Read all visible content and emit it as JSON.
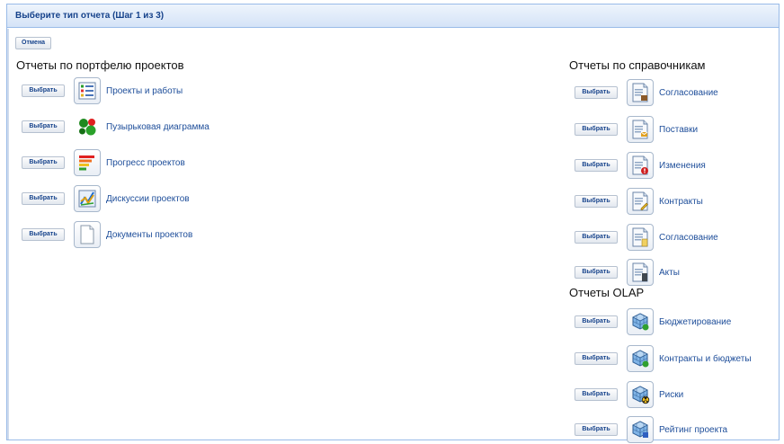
{
  "window": {
    "title": "Выберите тип отчета (Шаг 1 из 3)"
  },
  "toolbar": {
    "cancel_label": "Отмена"
  },
  "select_label": "Выбрать",
  "sections": {
    "portfolio": {
      "title": "Отчеты по портфелю проектов",
      "items": [
        {
          "label": "Проекты и работы",
          "icon": "task-list-icon"
        },
        {
          "label": "Пузырьковая диаграмма",
          "icon": "bubble-chart-icon"
        },
        {
          "label": "Прогресс проектов",
          "icon": "progress-bars-icon"
        },
        {
          "label": "Дискуссии проектов",
          "icon": "discussion-chart-icon"
        },
        {
          "label": "Документы проектов",
          "icon": "blank-document-icon"
        }
      ]
    },
    "references": {
      "title": "Отчеты по справочникам",
      "items": [
        {
          "label": "Согласование",
          "icon": "document-approval-icon"
        },
        {
          "label": "Поставки",
          "icon": "document-delivery-icon"
        },
        {
          "label": "Изменения",
          "icon": "document-changes-icon"
        },
        {
          "label": "Контракты",
          "icon": "document-contract-icon"
        },
        {
          "label": "Согласование",
          "icon": "document-approval-icon"
        },
        {
          "label": "Акты",
          "icon": "document-acts-icon"
        }
      ]
    },
    "olap": {
      "title": "Отчеты OLAP",
      "items": [
        {
          "label": "Бюджетирование",
          "icon": "olap-cube-icon"
        },
        {
          "label": "Контракты и бюджеты",
          "icon": "olap-cube-icon"
        },
        {
          "label": "Риски",
          "icon": "olap-cube-risk-icon"
        },
        {
          "label": "Рейтинг проекта",
          "icon": "olap-cube-icon"
        }
      ]
    }
  }
}
